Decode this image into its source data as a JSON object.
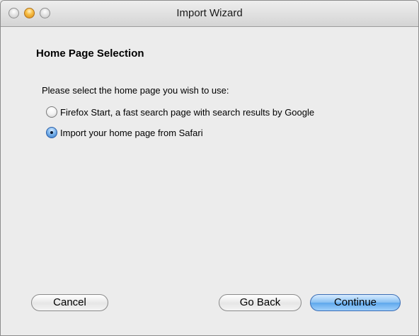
{
  "window": {
    "title": "Import Wizard"
  },
  "page": {
    "heading": "Home Page Selection",
    "prompt": "Please select the home page you wish to use:"
  },
  "options": [
    {
      "label": "Firefox Start, a fast search page with search results by Google",
      "selected": false
    },
    {
      "label": "Import your home page from Safari",
      "selected": true
    }
  ],
  "buttons": {
    "cancel": "Cancel",
    "go_back": "Go Back",
    "continue": "Continue"
  },
  "colors": {
    "default_button": "#5ea8ec",
    "window_background": "#ececec"
  }
}
